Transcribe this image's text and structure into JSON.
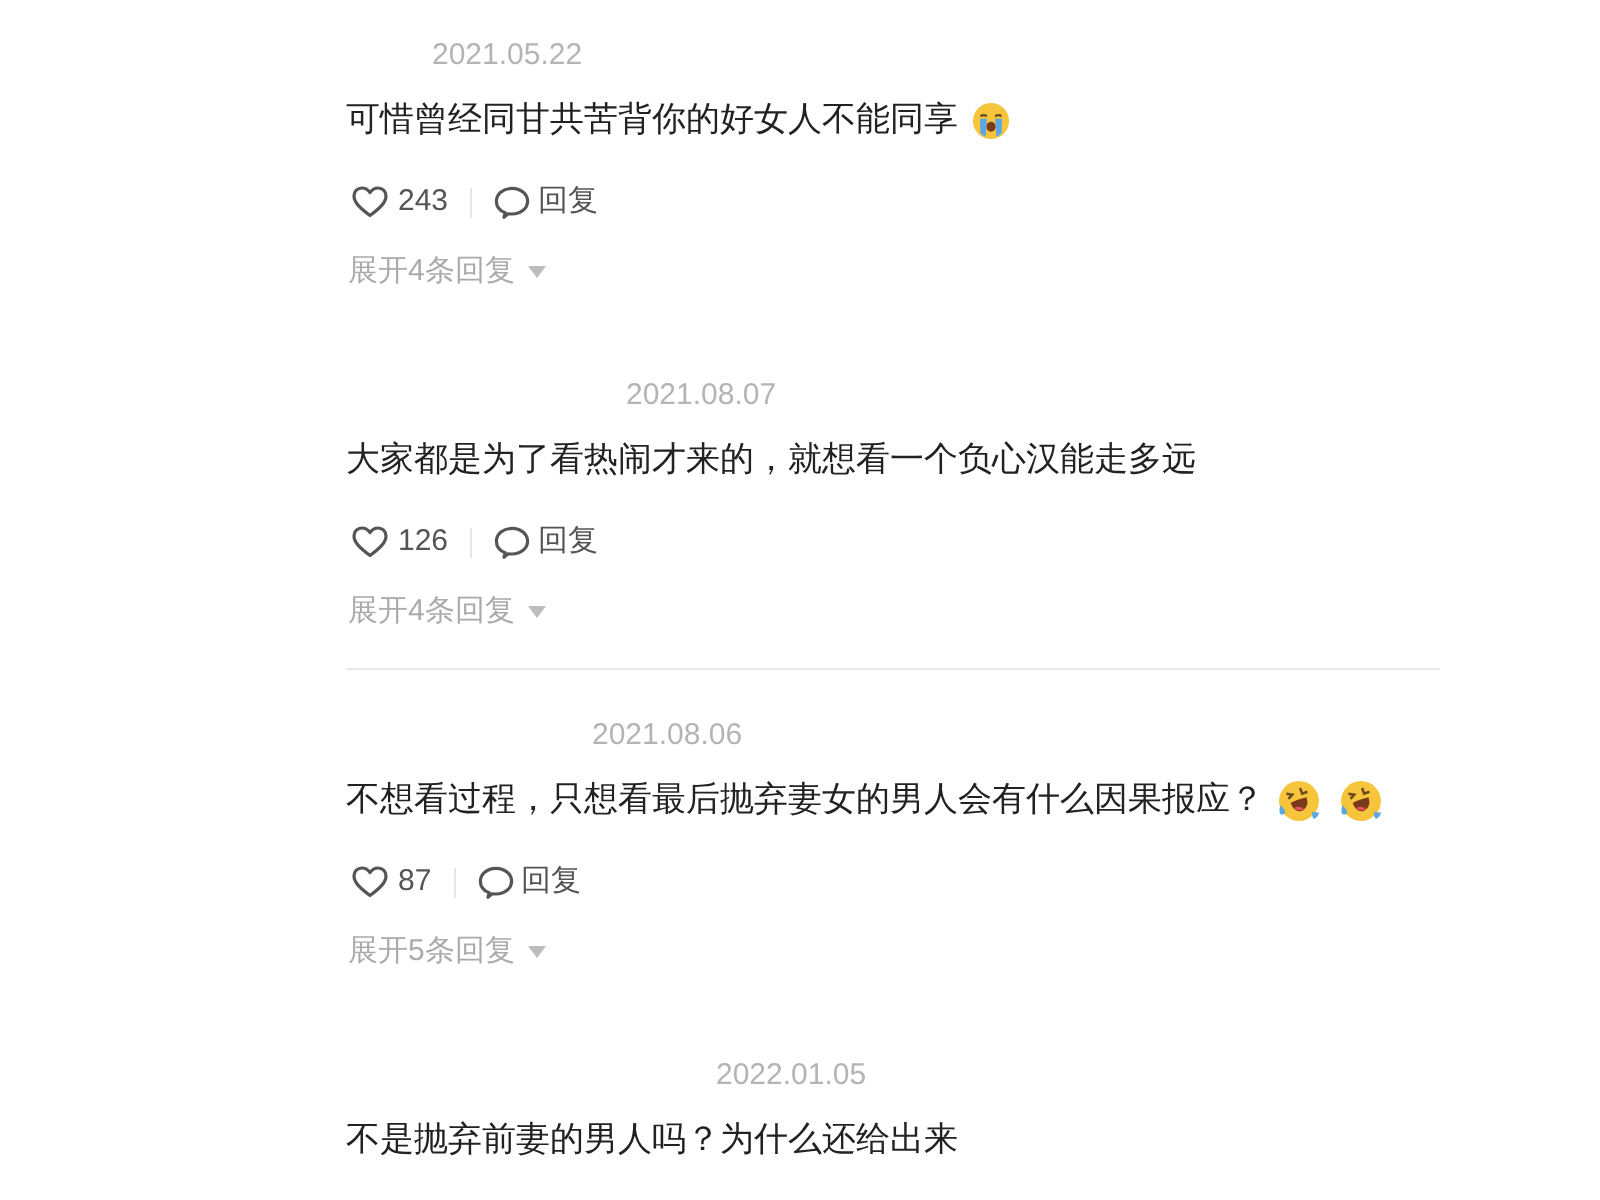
{
  "comments": [
    {
      "date": "2021.05.22",
      "text": "可惜曾经同甘共苦背你的好女人不能同享",
      "emoji": [
        {
          "kind": "crying"
        }
      ],
      "likes": "243",
      "reply_label": "回复",
      "expand_label": "展开4条回复",
      "divider_below": false
    },
    {
      "date": "2021.08.07",
      "text": "大家都是为了看热闹才来的，就想看一个负心汉能走多远",
      "likes": "126",
      "reply_label": "回复",
      "expand_label": "展开4条回复",
      "divider_below": true
    },
    {
      "date": "2021.08.06",
      "text": "不想看过程，只想看最后抛弃妻女的男人会有什么因果报应？",
      "emoji": [
        {
          "kind": "laughing"
        },
        {
          "kind": "laughing"
        }
      ],
      "likes": "87",
      "reply_label": "回复",
      "expand_label": "展开5条回复",
      "divider_below": false
    },
    {
      "date": "2022.01.05",
      "text": "不是抛弃前妻的男人吗？为什么还给出来",
      "divider_below": false
    }
  ]
}
